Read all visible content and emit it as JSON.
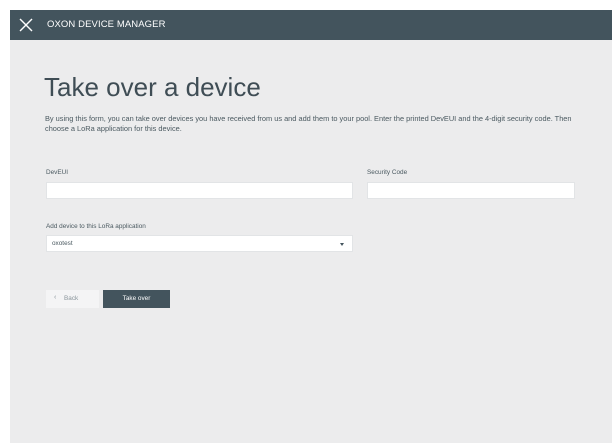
{
  "header": {
    "app_title": "OXON DEVICE MANAGER",
    "logo_icon": "close-x-icon",
    "background_color": "#43545d"
  },
  "page": {
    "title": "Take over a device",
    "description": "By using this form, you can take over devices you have received from us and add them to your pool. Enter the printed DevEUI and the 4-digit security code. Then choose a LoRa application for this device."
  },
  "form": {
    "deveui_label": "DevEUI",
    "deveui_value": "",
    "security_code_label": "Security Code",
    "security_code_value": "",
    "application_label": "Add device to this LoRa application",
    "application_selected": "oxotest"
  },
  "actions": {
    "back_label": "Back",
    "back_icon": "chevron-left-icon",
    "takeover_label": "Take over",
    "primary_color": "#43545d"
  }
}
